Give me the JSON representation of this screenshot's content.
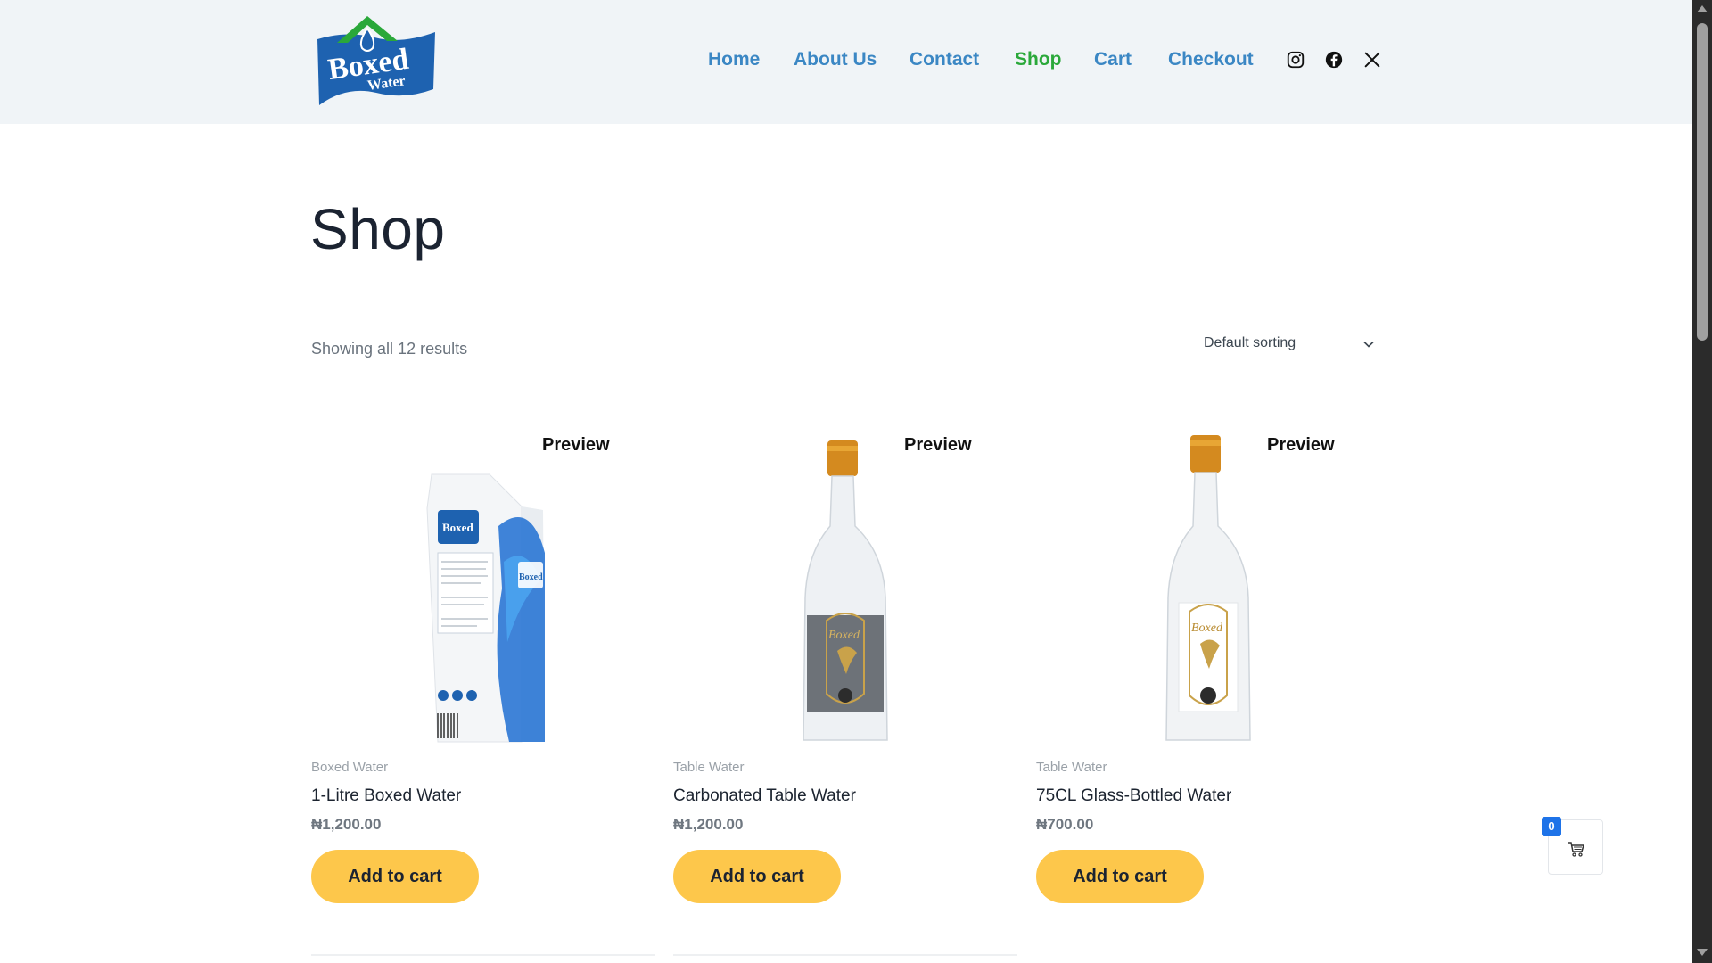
{
  "header": {
    "logo": {
      "text_top": "Boxed",
      "text_bottom": "Water",
      "colors": {
        "blue": "#1e62b0",
        "green": "#2aa83a"
      }
    },
    "nav": [
      {
        "label": "Home",
        "active": false
      },
      {
        "label": "About Us",
        "active": false
      },
      {
        "label": "Contact",
        "active": false
      },
      {
        "label": "Shop",
        "active": true
      },
      {
        "label": "Cart",
        "active": false
      },
      {
        "label": "Checkout",
        "active": false
      }
    ],
    "social": [
      {
        "icon": "instagram-icon"
      },
      {
        "icon": "facebook-icon"
      },
      {
        "icon": "x-twitter-icon"
      }
    ]
  },
  "page": {
    "title": "Shop",
    "result_count": "Showing all 12 results",
    "sort": {
      "selected": "Default sorting",
      "icon": "chevron-down-icon"
    }
  },
  "products": [
    {
      "preview": "Preview",
      "category": "Boxed Water",
      "title": "1-Litre Boxed Water",
      "price": "₦1,200.00",
      "button": "Add to cart",
      "image": "carton"
    },
    {
      "preview": "Preview",
      "category": "Table Water",
      "title": "Carbonated Table Water",
      "price": "₦1,200.00",
      "button": "Add to cart",
      "image": "bottle-grey"
    },
    {
      "preview": "Preview",
      "category": "Table Water",
      "title": "75CL Glass-Bottled Water",
      "price": "₦700.00",
      "button": "Add to cart",
      "image": "bottle-clear"
    }
  ],
  "floating_cart": {
    "count": "0",
    "icon": "shopping-cart-icon"
  },
  "colors": {
    "accent_button": "#fdc74b",
    "nav_link": "#3b87c4",
    "nav_active": "#2aa83a",
    "header_bg": "#f0f4f7",
    "badge": "#1e73e8"
  }
}
